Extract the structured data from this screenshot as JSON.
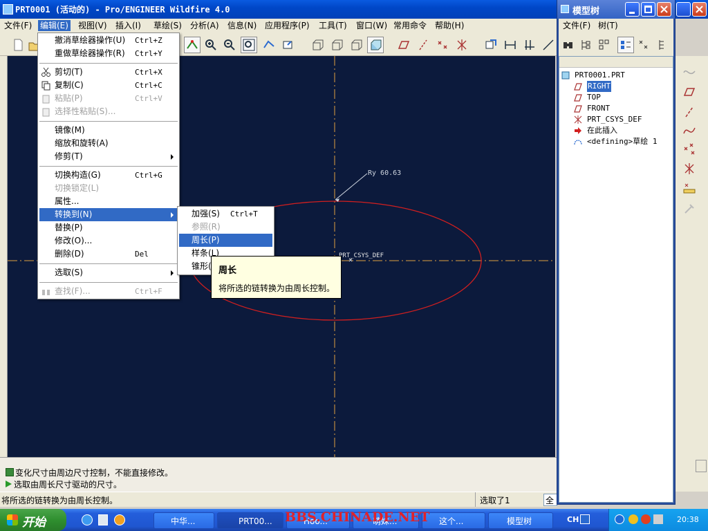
{
  "window": {
    "title": "PRT0001 (活动的) - Pro/ENGINEER Wildfire 4.0"
  },
  "menubar": {
    "items": [
      "文件(F)",
      "编辑(E)",
      "视图(V)",
      "插入(I)",
      "草绘(S)",
      "分析(A)",
      "信息(N)",
      "应用程序(P)",
      "工具(T)",
      "窗口(W)",
      "常用命令",
      "帮助(H)"
    ]
  },
  "edit_menu": {
    "items": [
      {
        "label": "撤消草绘器操作(U)",
        "shortcut": "Ctrl+Z"
      },
      {
        "label": "重做草绘器操作(R)",
        "shortcut": "Ctrl+Y"
      },
      {
        "label": "剪切(T)",
        "shortcut": "Ctrl+X"
      },
      {
        "label": "复制(C)",
        "shortcut": "Ctrl+C"
      },
      {
        "label": "粘贴(P)",
        "shortcut": "Ctrl+V"
      },
      {
        "label": "选择性粘贴(S)...",
        "shortcut": ""
      },
      {
        "label": "镜像(M)",
        "shortcut": ""
      },
      {
        "label": "缩放和旋转(A)",
        "shortcut": ""
      },
      {
        "label": "修剪(T)",
        "shortcut": ""
      },
      {
        "label": "切换构造(G)",
        "shortcut": "Ctrl+G"
      },
      {
        "label": "切换锁定(L)",
        "shortcut": ""
      },
      {
        "label": "属性...",
        "shortcut": ""
      },
      {
        "label": "转换到(N)",
        "shortcut": ""
      },
      {
        "label": "替换(P)",
        "shortcut": ""
      },
      {
        "label": "修改(O)...",
        "shortcut": ""
      },
      {
        "label": "删除(D)",
        "shortcut": "Del"
      },
      {
        "label": "选取(S)",
        "shortcut": ""
      },
      {
        "label": "查找(F)...",
        "shortcut": "Ctrl+F"
      }
    ]
  },
  "convert_submenu": {
    "items": [
      {
        "label": "加强(S)",
        "shortcut": "Ctrl+T"
      },
      {
        "label": "参照(R)",
        "shortcut": ""
      },
      {
        "label": "周长(P)",
        "shortcut": ""
      },
      {
        "label": "样条(L)",
        "shortcut": ""
      },
      {
        "label": "锥形(C)",
        "shortcut": ""
      }
    ]
  },
  "tooltip": {
    "title": "周长",
    "body": "将所选的链转换为由周长控制。"
  },
  "canvas": {
    "dimension_label": "Ry 60.63",
    "csys_label": "PRT_CSYS_DEF",
    "ellipse_color": "#d21f1f",
    "axis_color": "#e0a040",
    "background": "#0c1a3c"
  },
  "model_tree": {
    "title": "模型树",
    "menu": [
      "文件(F)",
      "树(T)"
    ],
    "items": [
      {
        "label": "PRT0001.PRT",
        "icon": "part-icon"
      },
      {
        "label": "RIGHT",
        "icon": "datum-plane-icon",
        "selected": true
      },
      {
        "label": "TOP",
        "icon": "datum-plane-icon"
      },
      {
        "label": "FRONT",
        "icon": "datum-plane-icon"
      },
      {
        "label": "PRT_CSYS_DEF",
        "icon": "csys-icon"
      },
      {
        "label": "在此插入",
        "icon": "insert-arrow-icon"
      },
      {
        "label": "<defining>草绘 1",
        "icon": "sketch-icon"
      }
    ]
  },
  "messages": [
    "变化尺寸由周边尺寸控制，不能直接修改。",
    "选取由周长尺寸驱动的尺寸。"
  ],
  "statusbar": {
    "left": "将所选的链转换为由周长控制。",
    "right": "选取了1",
    "filter": "全"
  },
  "taskbar": {
    "start": "开始",
    "tasks": [
      "中华...",
      "PRT00...",
      "Hoo...",
      "萌妹...",
      "这个...",
      "模型树"
    ],
    "watermark": "BBS.CHINADE.NET",
    "lang": "CH",
    "time": "20:38"
  }
}
